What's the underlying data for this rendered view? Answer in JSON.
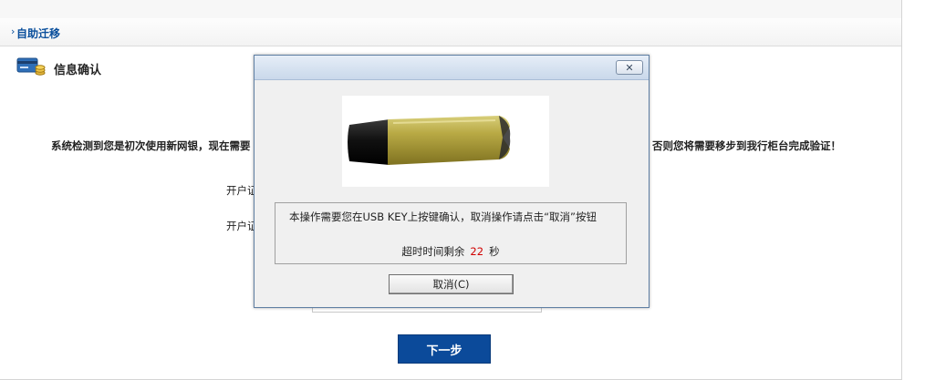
{
  "breadcrumb": {
    "arrow": "›",
    "label": "自助迁移"
  },
  "section": {
    "title": "信息确认"
  },
  "background": {
    "notice_left": "系统检测到您是初次使用新网银，现在需要",
    "notice_right": "否则您将需要移步到我行柜台完成验证！",
    "label_1": "开户证",
    "label_2": "开户证",
    "next_label": "下一步"
  },
  "dialog": {
    "close_glyph": "✕",
    "message": "本操作需要您在USB KEY上按键确认，取消操作请点击“取消”按钮",
    "timeout_prefix": "超时时间剩余",
    "timeout_value": "22",
    "timeout_unit": "秒",
    "cancel_label": "取消(C)"
  },
  "colors": {
    "brand_blue": "#0b4a9a",
    "link_blue": "#0a4f9c",
    "countdown_red": "#d00000"
  },
  "icons": {
    "section": "bank-card-coins-icon",
    "usb": "usb-key-image",
    "close": "close-icon"
  }
}
